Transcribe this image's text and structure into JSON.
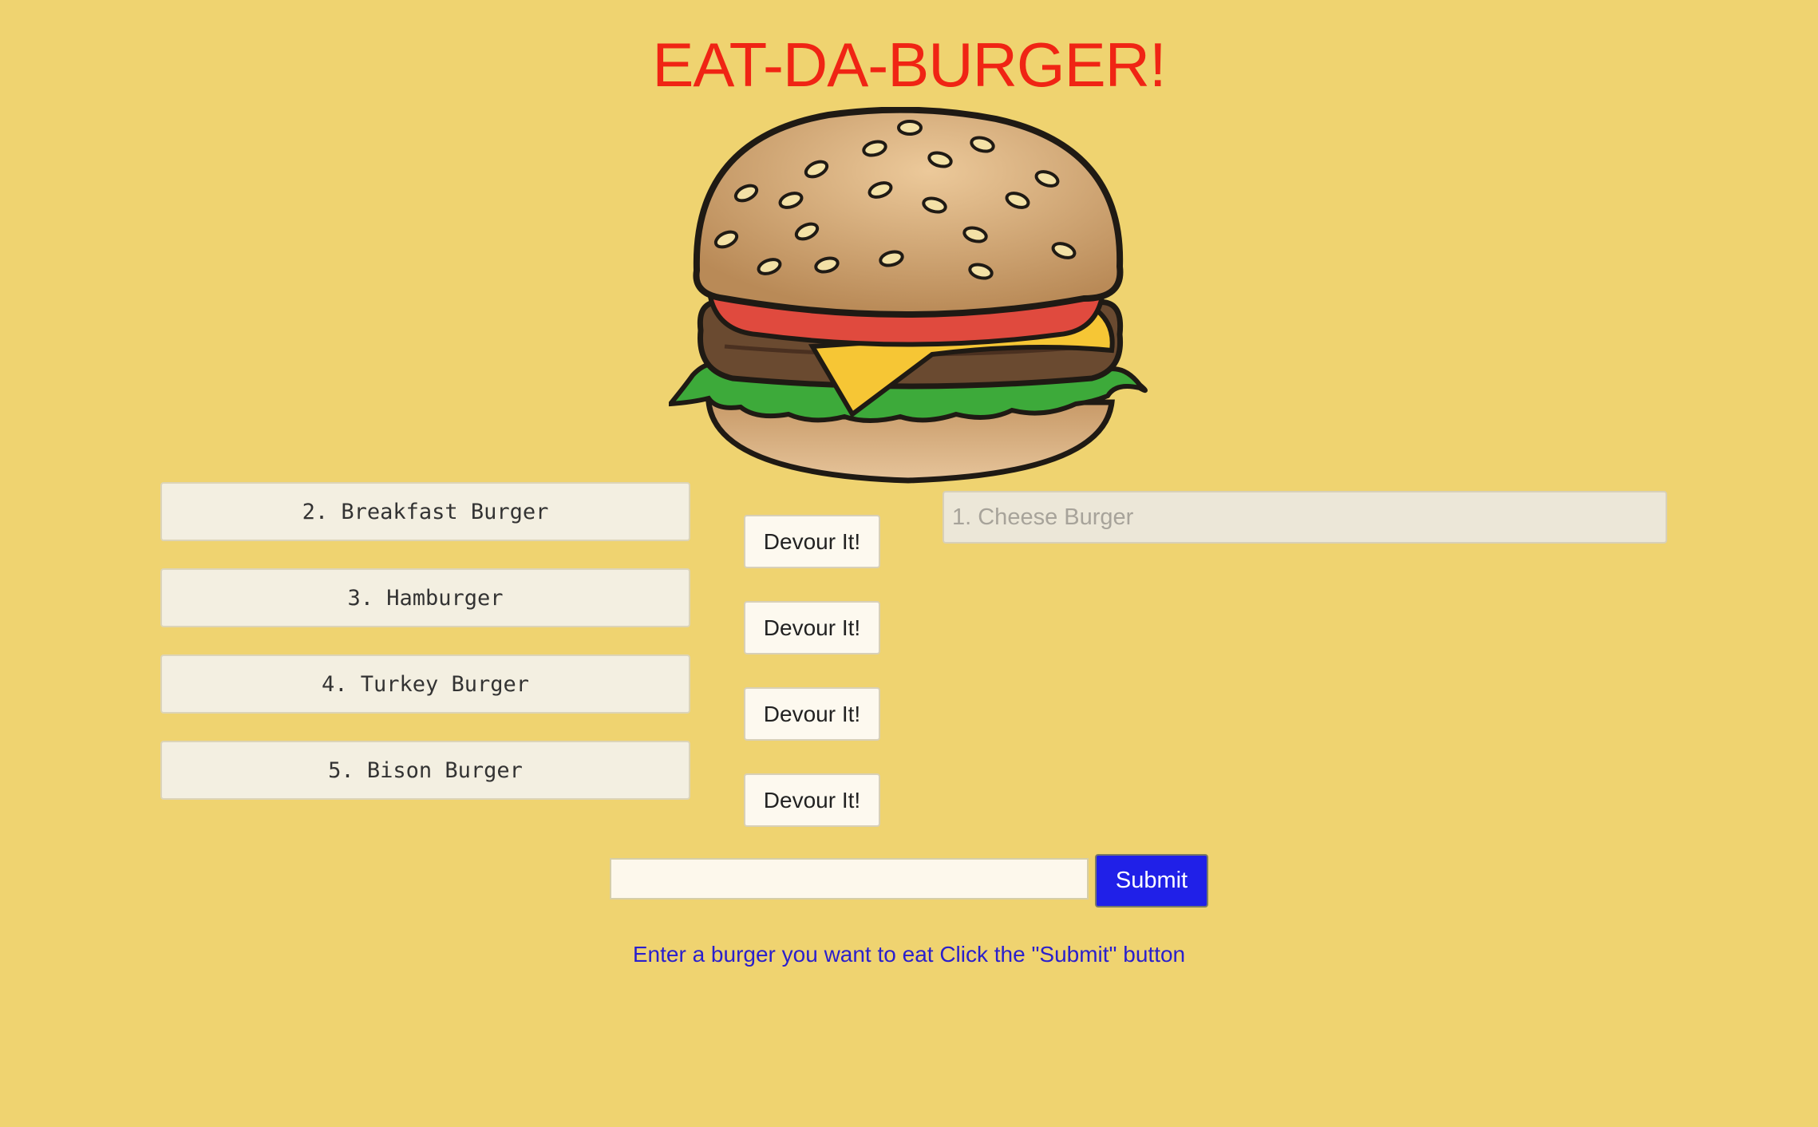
{
  "header": {
    "title": "EAT-DA-BURGER!"
  },
  "burger_image": {
    "icon": "burger-illustration"
  },
  "uneaten_burgers": [
    {
      "label": "2. Breakfast Burger",
      "button_label": "Devour It!"
    },
    {
      "label": "3. Hamburger",
      "button_label": "Devour It!"
    },
    {
      "label": "4. Turkey Burger",
      "button_label": "Devour It!"
    },
    {
      "label": "5. Bison Burger",
      "button_label": "Devour It!"
    }
  ],
  "devoured_burgers": [
    {
      "label": "1. Cheese Burger"
    }
  ],
  "form": {
    "input_value": "",
    "submit_label": "Submit",
    "instructions": "Enter a burger you want to eat Click the \"Submit\" button"
  },
  "colors": {
    "background": "#efd370",
    "title": "#f02414",
    "submit": "#2020e8",
    "instructions": "#2a1fcc"
  }
}
